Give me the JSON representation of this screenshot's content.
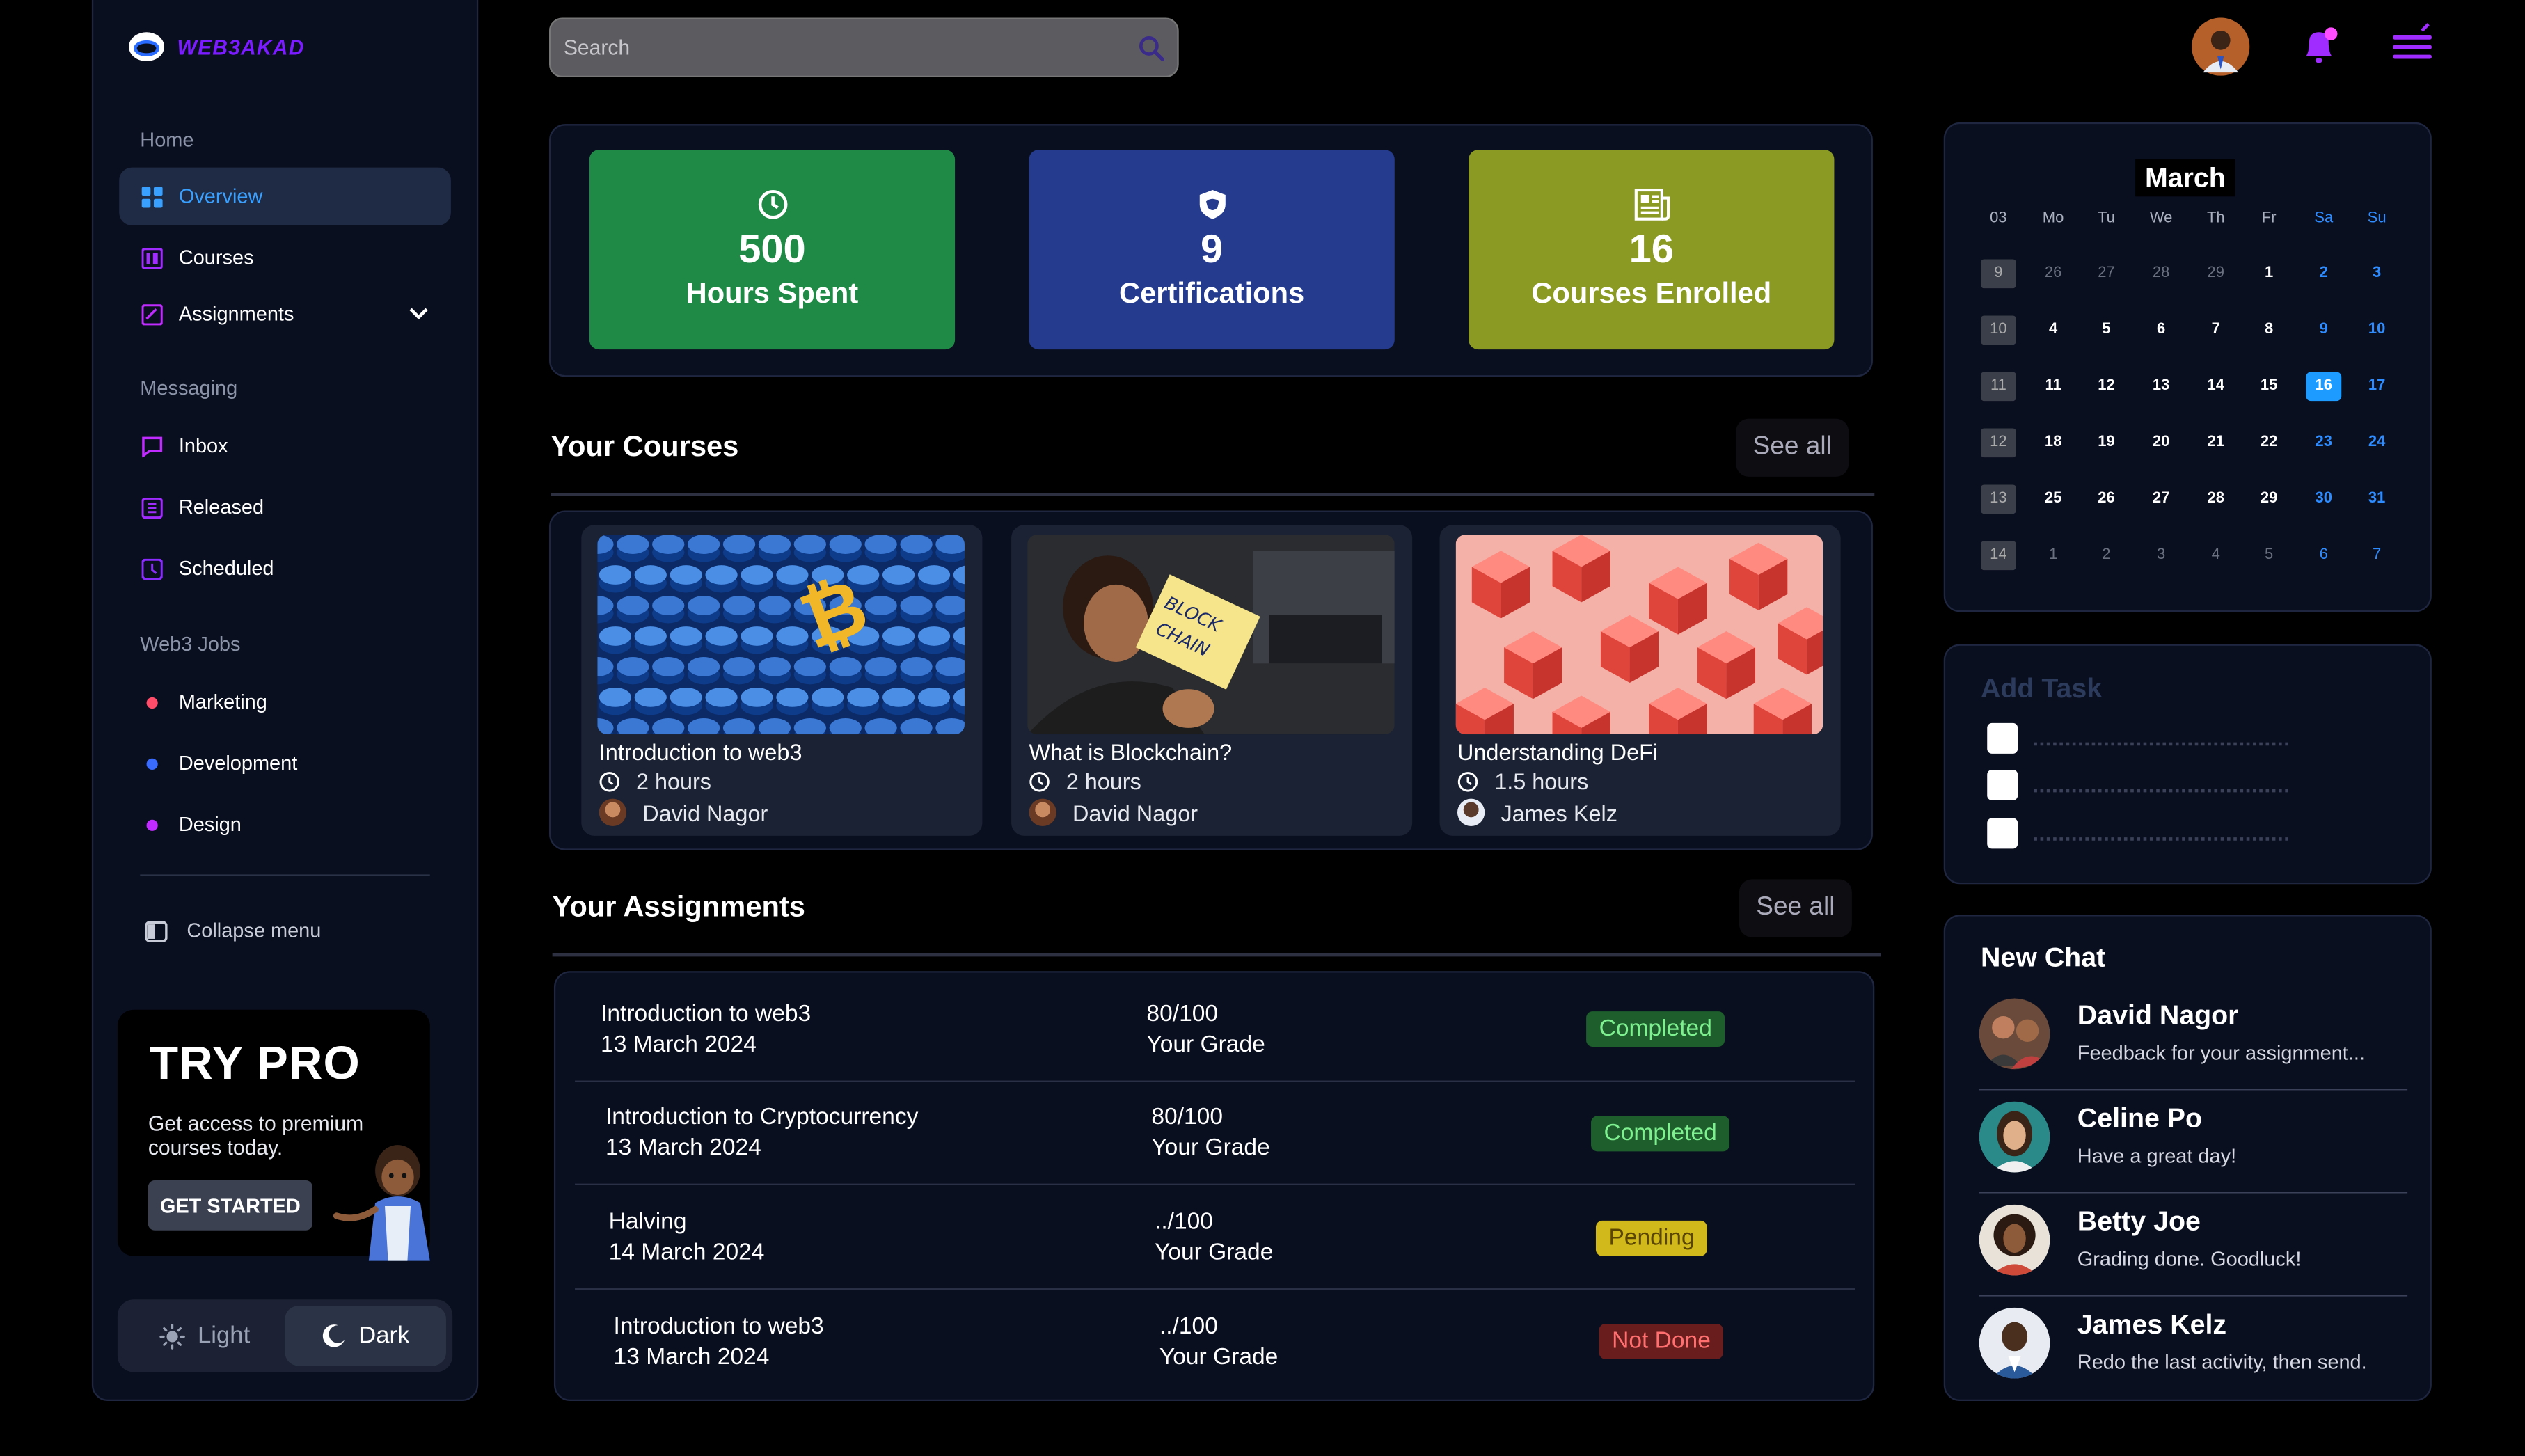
{
  "brand": {
    "name": "WEB3AKAD"
  },
  "sidebar": {
    "home_label": "Home",
    "home_items": [
      {
        "label": "Overview",
        "icon": "grid-icon",
        "color": "#3aa0ff"
      },
      {
        "label": "Courses",
        "icon": "book-icon",
        "color": "#a12cff"
      },
      {
        "label": "Assignments",
        "icon": "clipboard-icon",
        "color": "#c02cff"
      }
    ],
    "messaging_label": "Messaging",
    "messaging_items": [
      {
        "label": "Inbox",
        "icon": "message-icon"
      },
      {
        "label": "Released",
        "icon": "released-icon"
      },
      {
        "label": "Scheduled",
        "icon": "scheduled-icon"
      }
    ],
    "jobs_label": "Web3 Jobs",
    "jobs_items": [
      {
        "label": "Marketing",
        "dot": "#ff4d6a"
      },
      {
        "label": "Development",
        "dot": "#3a6bff"
      },
      {
        "label": "Design",
        "dot": "#c02cff"
      }
    ],
    "collapse_label": "Collapse menu",
    "promo": {
      "title": "TRY PRO",
      "text": "Get access to premium courses today.",
      "button": "GET STARTED"
    },
    "theme": {
      "light": "Light",
      "dark": "Dark",
      "selected": "Dark"
    }
  },
  "header": {
    "search_placeholder": "Search"
  },
  "stats": [
    {
      "value": "500",
      "label": "Hours Spent",
      "icon": "clock-icon",
      "color": "#1f8a45"
    },
    {
      "value": "9",
      "label": "Certifications",
      "icon": "shield-icon",
      "color": "#243b8e"
    },
    {
      "value": "16",
      "label": "Courses Enrolled",
      "icon": "newspaper-icon",
      "color": "#8a9a23"
    }
  ],
  "courses": {
    "title": "Your Courses",
    "see_all": "See all",
    "items": [
      {
        "title": "Introduction to web3",
        "duration": "2 hours",
        "author": "David Nagor"
      },
      {
        "title": "What is Blockchain?",
        "duration": "2 hours",
        "author": "David Nagor"
      },
      {
        "title": "Understanding DeFi",
        "duration": "1.5 hours",
        "author": "James Kelz"
      }
    ]
  },
  "assignments": {
    "title": "Your Assignments",
    "see_all": "See all",
    "rows": [
      {
        "name": "Introduction to web3",
        "date": "13 March 2024",
        "score": "80/100",
        "score_label": "Your Grade",
        "status": "Completed"
      },
      {
        "name": "Introduction to Cryptocurrency",
        "date": "13 March 2024",
        "score": "80/100",
        "score_label": "Your Grade",
        "status": "Completed"
      },
      {
        "name": "Halving",
        "date": "14 March 2024",
        "score": "../100",
        "score_label": "Your Grade",
        "status": "Pending"
      },
      {
        "name": "Introduction to web3",
        "date": "13 March 2024",
        "score": "../100",
        "score_label": "Your Grade",
        "status": "Not Done"
      }
    ]
  },
  "calendar": {
    "month": "March",
    "headers": [
      "03",
      "Mo",
      "Tu",
      "We",
      "Th",
      "Fr",
      "Sa",
      "Su"
    ],
    "weeks": [
      [
        "9",
        "26",
        "27",
        "28",
        "29",
        "1",
        "2",
        "3"
      ],
      [
        "10",
        "4",
        "5",
        "6",
        "7",
        "8",
        "9",
        "10"
      ],
      [
        "11",
        "11",
        "12",
        "13",
        "14",
        "15",
        "16",
        "17"
      ],
      [
        "12",
        "18",
        "19",
        "20",
        "21",
        "22",
        "23",
        "24"
      ],
      [
        "13",
        "25",
        "26",
        "27",
        "28",
        "29",
        "30",
        "31"
      ],
      [
        "14",
        "1",
        "2",
        "3",
        "4",
        "5",
        "6",
        "7"
      ]
    ],
    "selected_day": "16"
  },
  "tasks": {
    "title": "Add Task",
    "count": 3
  },
  "chat": {
    "title": "New Chat",
    "items": [
      {
        "name": "David Nagor",
        "message": "Feedback for your assignment..."
      },
      {
        "name": "Celine Po",
        "message": "Have a great day!"
      },
      {
        "name": "Betty Joe",
        "message": "Grading done. Goodluck!"
      },
      {
        "name": "James Kelz",
        "message": "Redo the last activity, then send."
      }
    ]
  }
}
